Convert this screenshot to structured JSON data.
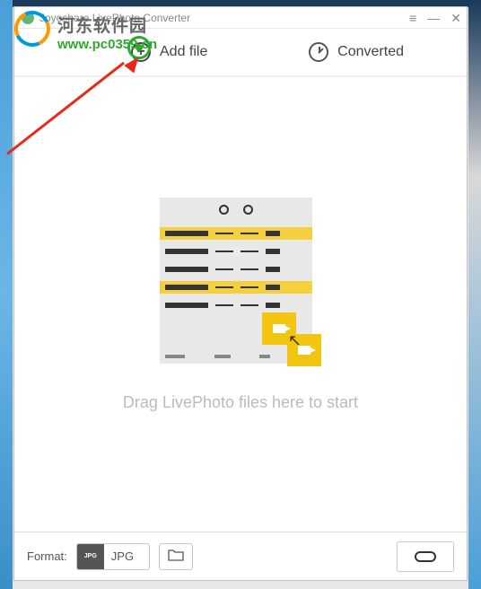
{
  "window": {
    "title": "Joyoshare LivePhoto Converter"
  },
  "tabs": {
    "add_file": "Add file",
    "converted": "Converted"
  },
  "main": {
    "drop_hint": "Drag LivePhoto files here to start"
  },
  "footer": {
    "format_label": "Format:",
    "format_icon_text": "JPG",
    "format_value": "JPG"
  },
  "watermark": {
    "site_name_cn": "河东软件园",
    "site_url": "www.pc0359.cn"
  }
}
